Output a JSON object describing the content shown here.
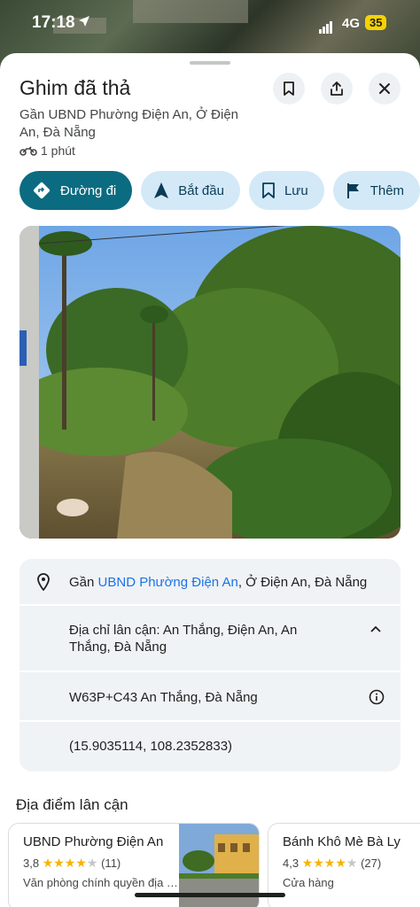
{
  "status": {
    "time": "17:18",
    "network": "4G",
    "battery": "35"
  },
  "header": {
    "title": "Ghim đã thả",
    "subtitle": "Gần UBND Phường Điện An, Ở Điện An, Đà Nẵng",
    "travel_time": "1 phút",
    "icons": {
      "save": "bookmark-icon",
      "share": "share-icon",
      "close": "close-icon",
      "travel": "motorbike-icon"
    }
  },
  "actions": [
    {
      "label": "Đường đi",
      "icon": "directions-icon"
    },
    {
      "label": "Bắt đầu",
      "icon": "navigation-icon"
    },
    {
      "label": "Lưu",
      "icon": "bookmark-icon"
    },
    {
      "label": "Thêm",
      "icon": "flag-icon"
    }
  ],
  "info": {
    "near_prefix": "Gần ",
    "near_link": "UBND Phường Điện An",
    "near_suffix": ", Ở Điện An, Đà Nẵng",
    "nearby_address": "Địa chỉ lân cận: An Thắng, Điện An, An Thắng, Đà Nẵng",
    "plus_code": "W63P+C43 An Thắng, Đà Nẵng",
    "coordinates": "(15.9035114, 108.2352833)"
  },
  "nearby": {
    "title": "Địa điểm lân cận",
    "places": [
      {
        "name": "UBND Phường Điện An",
        "rating": "3,8",
        "stars": "★★★★",
        "stars_empty": "★",
        "reviews": "(11)",
        "category": "Văn phòng chính quyền địa phương"
      },
      {
        "name": "Bánh Khô Mè Bà Ly",
        "rating": "4,3",
        "stars": "★★★★",
        "stars_empty": "★",
        "reviews": "(27)",
        "category": "Cửa hàng"
      }
    ]
  },
  "colors": {
    "primary": "#0b6b80",
    "chip": "#d3e9f7",
    "link": "#1a73e8",
    "star": "#f6b400"
  }
}
